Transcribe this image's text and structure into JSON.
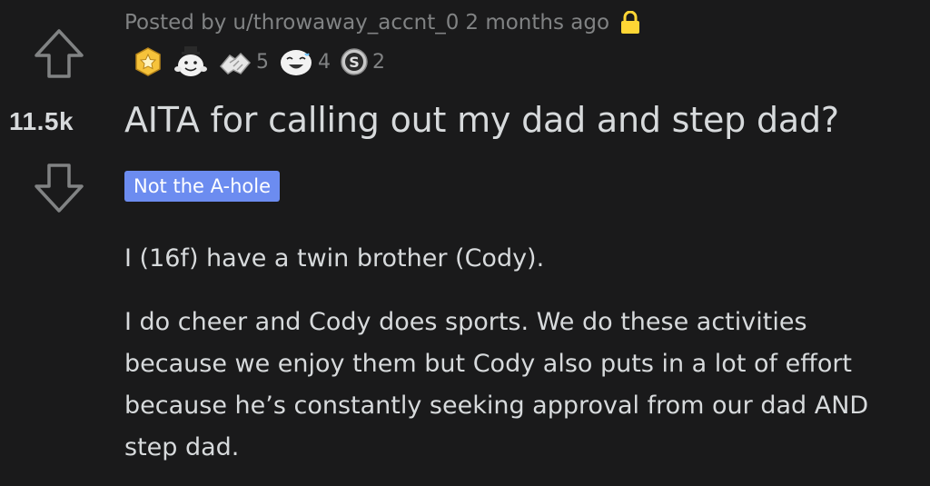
{
  "post": {
    "meta": {
      "prefix": "Posted by",
      "author": "u/throwaway_accnt_0",
      "time": "2 months ago",
      "locked_icon": "lock-icon"
    },
    "awards": [
      {
        "icon": "gold-medal-icon",
        "count": ""
      },
      {
        "icon": "wholesome-seal-icon",
        "count": ""
      },
      {
        "icon": "hands-icon",
        "count": "5"
      },
      {
        "icon": "laughing-face-icon",
        "count": "4"
      },
      {
        "icon": "silver-coin-icon",
        "count": "2"
      }
    ],
    "score": "11.5k",
    "title": "AITA for calling out my dad and step dad?",
    "flair": "Not the A-hole",
    "body": [
      "I (16f) have a twin brother (Cody).",
      "I do cheer and Cody does sports. We do these activities because we enjoy them but Cody also puts in a lot of effort because he’s constantly seeking approval from our dad AND step dad."
    ]
  },
  "colors": {
    "background": "#1a1a1b",
    "text": "#d7dadc",
    "muted": "#818384",
    "flair_bg": "#6c8cf0",
    "lock": "#ffd635"
  }
}
